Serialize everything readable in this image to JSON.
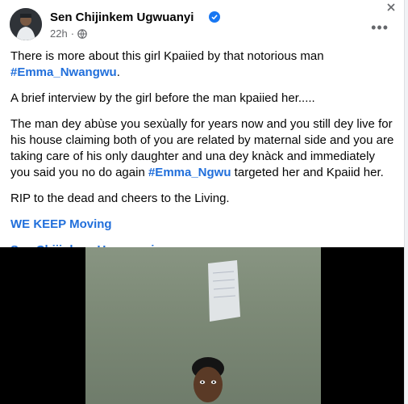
{
  "post": {
    "author": "Sen Chijinkem Ugwuanyi",
    "time": "22h",
    "separator": "·",
    "colors": {
      "link": "#216fdb",
      "verified": "#1877f2",
      "text": "#050505",
      "meta": "#65676b"
    },
    "icons": [
      "avatar",
      "verified-badge-icon",
      "globe-icon",
      "more-options-icon",
      "close-icon"
    ],
    "paragraph1_text": "There is more about this girl Kpaiied by that notorious man ",
    "paragraph1_hashtag": "#Emma_Nwangwu",
    "paragraph1_end": ".",
    "paragraph2": "A brief interview by the girl before the man kpaiied her.....",
    "paragraph3_text": "The man dey abùse you sexùally for years now and you still dey live for his house claiming both of you are related by maternal side and you are taking care of his only daughter and una dey knàck and immediately you said you no do again ",
    "paragraph3_hashtag": "#Emma_Ngwu",
    "paragraph3_end": " targeted her and Kpaiid her.",
    "paragraph4": "RIP to the dead and cheers to the Living.",
    "paragraph5": "WE KEEP Moving",
    "paragraph6": "Sen Chijinkem Ugwuanyi"
  }
}
